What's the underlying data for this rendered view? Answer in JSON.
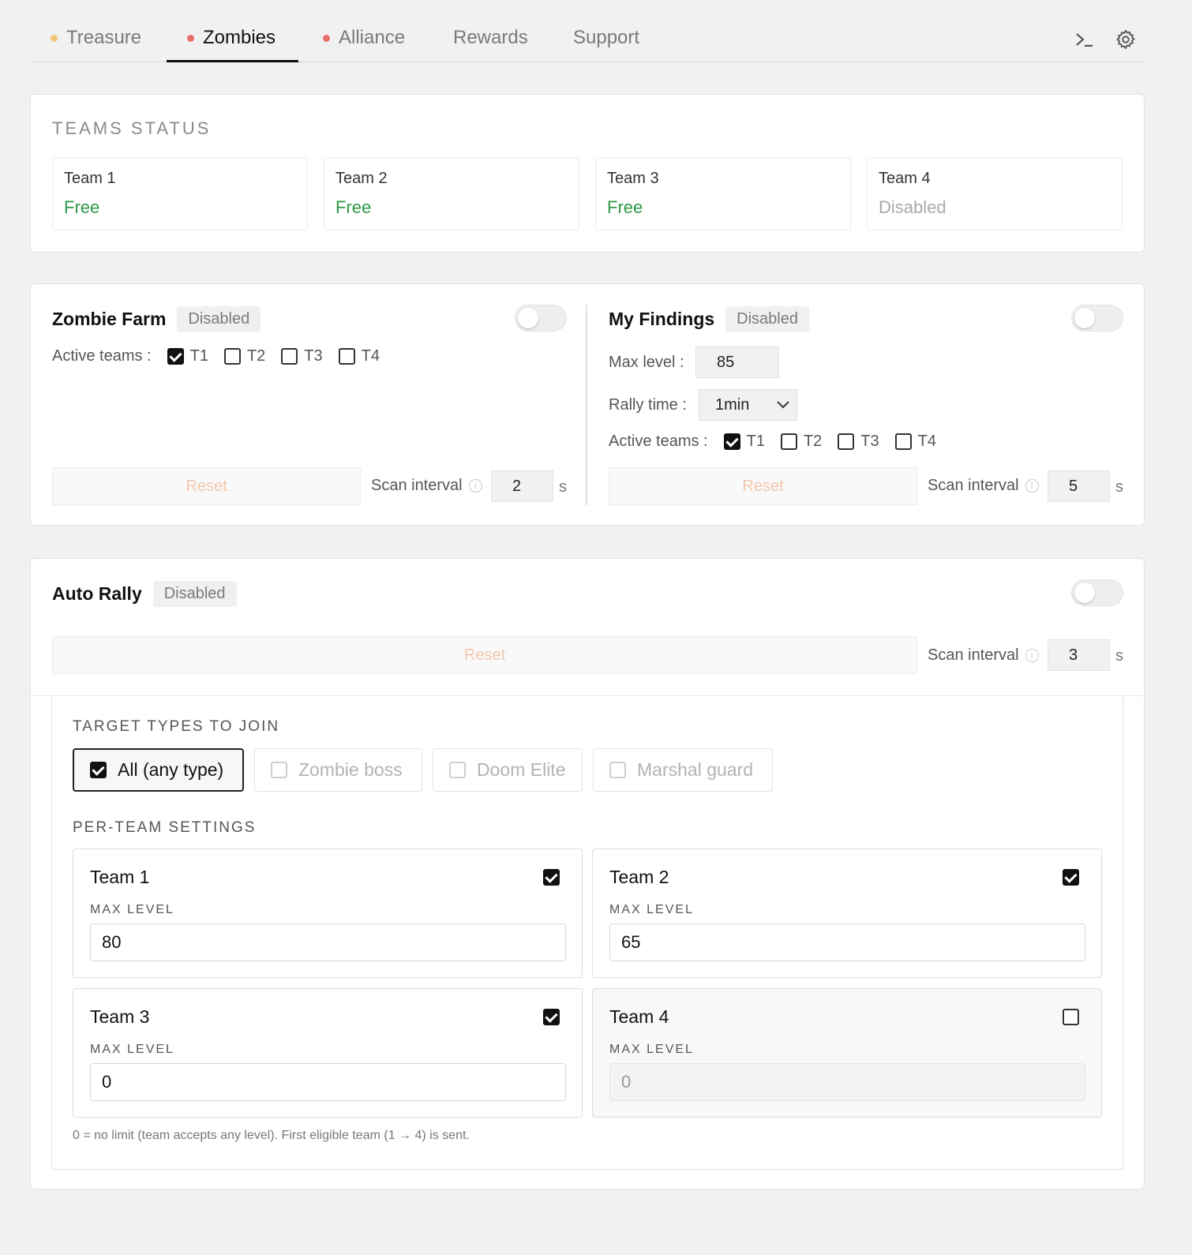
{
  "tabs": [
    {
      "label": "Treasure",
      "dot_color": "#f0c674",
      "active": false
    },
    {
      "label": "Zombies",
      "dot_color": "#e9706a",
      "active": true
    },
    {
      "label": "Alliance",
      "dot_color": "#e9706a",
      "active": false
    },
    {
      "label": "Rewards",
      "active": false
    },
    {
      "label": "Support",
      "active": false
    }
  ],
  "icons": {
    "terminal": "terminal-icon",
    "settings": "gear-icon"
  },
  "teams_status": {
    "title": "TEAMS STATUS",
    "teams": [
      {
        "name": "Team 1",
        "status": "Free"
      },
      {
        "name": "Team 2",
        "status": "Free"
      },
      {
        "name": "Team 3",
        "status": "Free"
      },
      {
        "name": "Team 4",
        "status": "Disabled"
      }
    ]
  },
  "zombie_farm": {
    "title": "Zombie Farm",
    "badge": "Disabled",
    "active_teams_label": "Active teams :",
    "teams": [
      {
        "label": "T1",
        "checked": true
      },
      {
        "label": "T2",
        "checked": false
      },
      {
        "label": "T3",
        "checked": false
      },
      {
        "label": "T4",
        "checked": false
      }
    ],
    "reset_label": "Reset",
    "scan_label": "Scan interval",
    "scan_value": "2",
    "scan_unit": "s"
  },
  "my_findings": {
    "title": "My Findings",
    "badge": "Disabled",
    "max_level_label": "Max level :",
    "max_level_value": "85",
    "rally_time_label": "Rally time :",
    "rally_time_value": "1min",
    "active_teams_label": "Active teams :",
    "teams": [
      {
        "label": "T1",
        "checked": true
      },
      {
        "label": "T2",
        "checked": false
      },
      {
        "label": "T3",
        "checked": false
      },
      {
        "label": "T4",
        "checked": false
      }
    ],
    "reset_label": "Reset",
    "scan_label": "Scan interval",
    "scan_value": "5",
    "scan_unit": "s"
  },
  "auto_rally": {
    "title": "Auto Rally",
    "badge": "Disabled",
    "reset_label": "Reset",
    "scan_label": "Scan interval",
    "scan_value": "3",
    "scan_unit": "s",
    "target_types_title": "TARGET TYPES TO JOIN",
    "target_types": [
      {
        "label": "All (any type)",
        "checked": true
      },
      {
        "label": "Zombie boss",
        "checked": false
      },
      {
        "label": "Doom Elite",
        "checked": false
      },
      {
        "label": "Marshal guard",
        "checked": false
      }
    ],
    "per_team_title": "PER-TEAM SETTINGS",
    "max_level_label": "MAX LEVEL",
    "per_team": [
      {
        "name": "Team 1",
        "enabled": true,
        "max_level": "80"
      },
      {
        "name": "Team 2",
        "enabled": true,
        "max_level": "65"
      },
      {
        "name": "Team 3",
        "enabled": true,
        "max_level": "0"
      },
      {
        "name": "Team 4",
        "enabled": false,
        "max_level": "0"
      }
    ],
    "note": "0 = no limit (team accepts any level). First eligible team (1 → 4) is sent."
  }
}
